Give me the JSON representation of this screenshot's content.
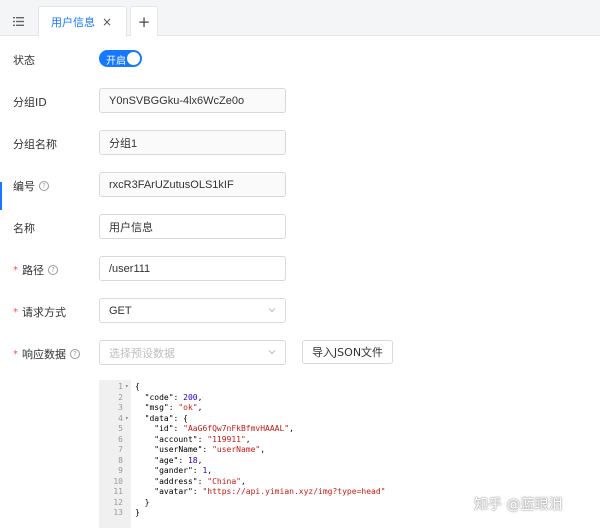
{
  "tabs": {
    "menu_icon": "list-icon",
    "active_label": "用户信息",
    "close_symbol": "×",
    "add_symbol": "+"
  },
  "form": {
    "status_label": "状态",
    "status_switch_text": "开启",
    "status_on": true,
    "group_id_label": "分组ID",
    "group_id_value": "Y0nSVBGGku-4lx6WcZe0o",
    "group_name_label": "分组名称",
    "group_name_value": "分组1",
    "number_label": "编号",
    "number_value": "rxcR3FArUZutusOLS1kIF",
    "name_label": "名称",
    "name_value": "用户信息",
    "path_label": "路径",
    "path_value": "/user111",
    "method_label": "请求方式",
    "method_value": "GET",
    "response_label": "响应数据",
    "response_placeholder": "选择预设数据",
    "import_button": "导入JSON文件",
    "required_mark": "*",
    "help_mark": "?"
  },
  "editor": {
    "lines": [
      {
        "n": "1",
        "fold": "▾",
        "text": "{"
      },
      {
        "n": "2",
        "text": "  \"code\": 200,"
      },
      {
        "n": "3",
        "text": "  \"msg\": \"ok\","
      },
      {
        "n": "4",
        "fold": "▾",
        "text": "  \"data\": {"
      },
      {
        "n": "5",
        "text": "    \"id\": \"AaG6fQw7nFkBfmvHAAAL\","
      },
      {
        "n": "6",
        "text": "    \"account\": \"119911\","
      },
      {
        "n": "7",
        "text": "    \"userName\": \"userName\","
      },
      {
        "n": "8",
        "text": "    \"age\": 18,"
      },
      {
        "n": "9",
        "text": "    \"gander\": 1,"
      },
      {
        "n": "10",
        "text": "    \"address\": \"China\","
      },
      {
        "n": "11",
        "text": "    \"avatar\": \"https://api.yimian.xyz/img?type=head\""
      },
      {
        "n": "12",
        "text": "  }"
      },
      {
        "n": "13",
        "text": "}",
        "highlight": true
      }
    ]
  },
  "watermark": "知乎 @蓝眼泪",
  "colors": {
    "accent": "#1677ff",
    "required": "#ff4d4f",
    "string": "#c41a16",
    "number": "#1c00cf"
  }
}
